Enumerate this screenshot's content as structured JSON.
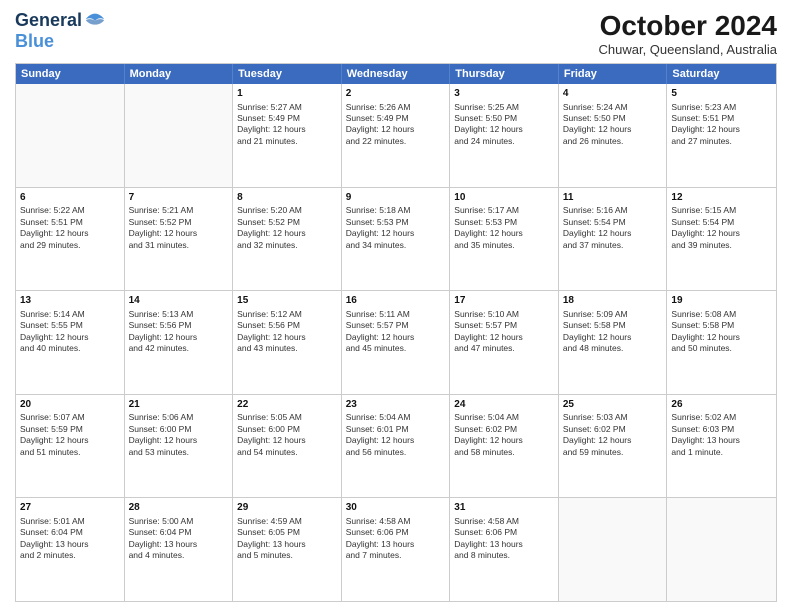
{
  "header": {
    "logo_line1": "General",
    "logo_line2": "Blue",
    "month_title": "October 2024",
    "location": "Chuwar, Queensland, Australia"
  },
  "days_of_week": [
    "Sunday",
    "Monday",
    "Tuesday",
    "Wednesday",
    "Thursday",
    "Friday",
    "Saturday"
  ],
  "weeks": [
    [
      {
        "day": "",
        "info": ""
      },
      {
        "day": "",
        "info": ""
      },
      {
        "day": "1",
        "info": "Sunrise: 5:27 AM\nSunset: 5:49 PM\nDaylight: 12 hours\nand 21 minutes."
      },
      {
        "day": "2",
        "info": "Sunrise: 5:26 AM\nSunset: 5:49 PM\nDaylight: 12 hours\nand 22 minutes."
      },
      {
        "day": "3",
        "info": "Sunrise: 5:25 AM\nSunset: 5:50 PM\nDaylight: 12 hours\nand 24 minutes."
      },
      {
        "day": "4",
        "info": "Sunrise: 5:24 AM\nSunset: 5:50 PM\nDaylight: 12 hours\nand 26 minutes."
      },
      {
        "day": "5",
        "info": "Sunrise: 5:23 AM\nSunset: 5:51 PM\nDaylight: 12 hours\nand 27 minutes."
      }
    ],
    [
      {
        "day": "6",
        "info": "Sunrise: 5:22 AM\nSunset: 5:51 PM\nDaylight: 12 hours\nand 29 minutes."
      },
      {
        "day": "7",
        "info": "Sunrise: 5:21 AM\nSunset: 5:52 PM\nDaylight: 12 hours\nand 31 minutes."
      },
      {
        "day": "8",
        "info": "Sunrise: 5:20 AM\nSunset: 5:52 PM\nDaylight: 12 hours\nand 32 minutes."
      },
      {
        "day": "9",
        "info": "Sunrise: 5:18 AM\nSunset: 5:53 PM\nDaylight: 12 hours\nand 34 minutes."
      },
      {
        "day": "10",
        "info": "Sunrise: 5:17 AM\nSunset: 5:53 PM\nDaylight: 12 hours\nand 35 minutes."
      },
      {
        "day": "11",
        "info": "Sunrise: 5:16 AM\nSunset: 5:54 PM\nDaylight: 12 hours\nand 37 minutes."
      },
      {
        "day": "12",
        "info": "Sunrise: 5:15 AM\nSunset: 5:54 PM\nDaylight: 12 hours\nand 39 minutes."
      }
    ],
    [
      {
        "day": "13",
        "info": "Sunrise: 5:14 AM\nSunset: 5:55 PM\nDaylight: 12 hours\nand 40 minutes."
      },
      {
        "day": "14",
        "info": "Sunrise: 5:13 AM\nSunset: 5:56 PM\nDaylight: 12 hours\nand 42 minutes."
      },
      {
        "day": "15",
        "info": "Sunrise: 5:12 AM\nSunset: 5:56 PM\nDaylight: 12 hours\nand 43 minutes."
      },
      {
        "day": "16",
        "info": "Sunrise: 5:11 AM\nSunset: 5:57 PM\nDaylight: 12 hours\nand 45 minutes."
      },
      {
        "day": "17",
        "info": "Sunrise: 5:10 AM\nSunset: 5:57 PM\nDaylight: 12 hours\nand 47 minutes."
      },
      {
        "day": "18",
        "info": "Sunrise: 5:09 AM\nSunset: 5:58 PM\nDaylight: 12 hours\nand 48 minutes."
      },
      {
        "day": "19",
        "info": "Sunrise: 5:08 AM\nSunset: 5:58 PM\nDaylight: 12 hours\nand 50 minutes."
      }
    ],
    [
      {
        "day": "20",
        "info": "Sunrise: 5:07 AM\nSunset: 5:59 PM\nDaylight: 12 hours\nand 51 minutes."
      },
      {
        "day": "21",
        "info": "Sunrise: 5:06 AM\nSunset: 6:00 PM\nDaylight: 12 hours\nand 53 minutes."
      },
      {
        "day": "22",
        "info": "Sunrise: 5:05 AM\nSunset: 6:00 PM\nDaylight: 12 hours\nand 54 minutes."
      },
      {
        "day": "23",
        "info": "Sunrise: 5:04 AM\nSunset: 6:01 PM\nDaylight: 12 hours\nand 56 minutes."
      },
      {
        "day": "24",
        "info": "Sunrise: 5:04 AM\nSunset: 6:02 PM\nDaylight: 12 hours\nand 58 minutes."
      },
      {
        "day": "25",
        "info": "Sunrise: 5:03 AM\nSunset: 6:02 PM\nDaylight: 12 hours\nand 59 minutes."
      },
      {
        "day": "26",
        "info": "Sunrise: 5:02 AM\nSunset: 6:03 PM\nDaylight: 13 hours\nand 1 minute."
      }
    ],
    [
      {
        "day": "27",
        "info": "Sunrise: 5:01 AM\nSunset: 6:04 PM\nDaylight: 13 hours\nand 2 minutes."
      },
      {
        "day": "28",
        "info": "Sunrise: 5:00 AM\nSunset: 6:04 PM\nDaylight: 13 hours\nand 4 minutes."
      },
      {
        "day": "29",
        "info": "Sunrise: 4:59 AM\nSunset: 6:05 PM\nDaylight: 13 hours\nand 5 minutes."
      },
      {
        "day": "30",
        "info": "Sunrise: 4:58 AM\nSunset: 6:06 PM\nDaylight: 13 hours\nand 7 minutes."
      },
      {
        "day": "31",
        "info": "Sunrise: 4:58 AM\nSunset: 6:06 PM\nDaylight: 13 hours\nand 8 minutes."
      },
      {
        "day": "",
        "info": ""
      },
      {
        "day": "",
        "info": ""
      }
    ]
  ]
}
